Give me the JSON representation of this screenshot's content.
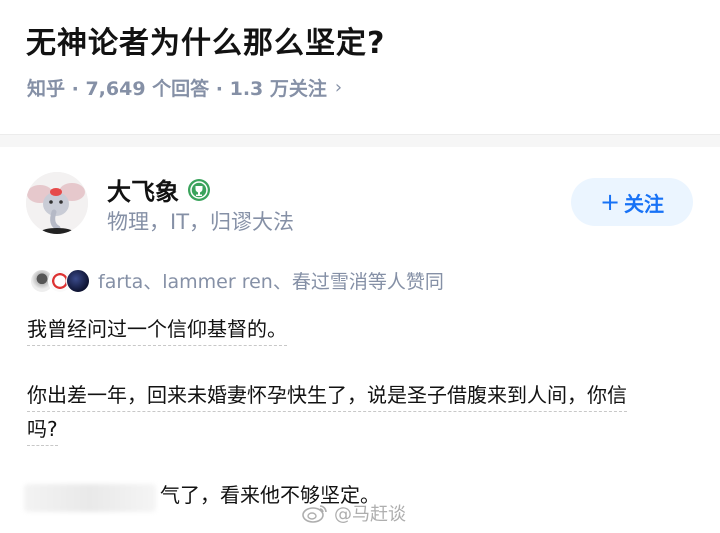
{
  "question": {
    "title": "无神论者为什么那么坚定?",
    "meta": "知乎 · 7,649 个回答 · 1.3 万关注",
    "chevron": "›"
  },
  "author": {
    "name": "大飞象",
    "bio": "物理，IT，归谬大法",
    "follow_label": "关注",
    "follow_plus": "+"
  },
  "voters": {
    "text": "farta、lammer ren、春过雪消等人赞同"
  },
  "answer": {
    "p1": "我曾经问过一个信仰基督的。",
    "p2a": "你出差一年，回来未婚妻怀孕快生了，说是圣子借腹来到人间，你信",
    "p2b": "吗?",
    "p3": "气了，看来他不够坚定。"
  },
  "watermark": {
    "text": "@马赶谈"
  },
  "colors": {
    "accent": "#1772f6",
    "meta_gray": "#8590a6",
    "follow_bg": "#ebf5ff",
    "badge_green": "#3aa35c"
  }
}
